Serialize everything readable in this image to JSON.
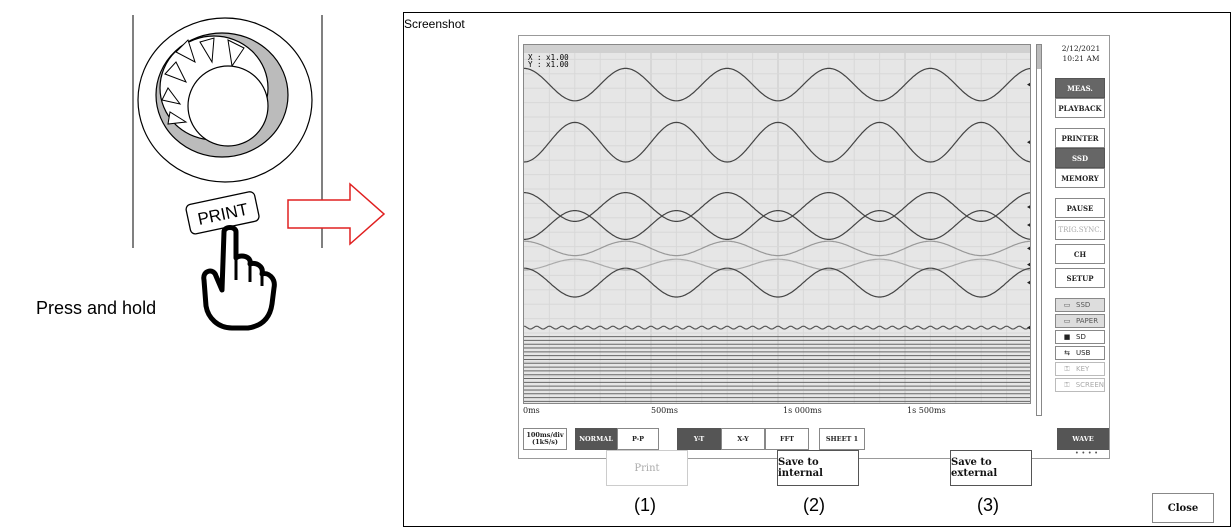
{
  "instruction": {
    "text": "Press and hold"
  },
  "illustration": {
    "print_key_label": "PRINT"
  },
  "dialog": {
    "title": "Screenshot",
    "buttons": {
      "print": "Print",
      "save_internal": "Save to internal",
      "save_external": "Save to external",
      "close": "Close"
    },
    "markers": [
      "(1)",
      "(2)",
      "(3)"
    ]
  },
  "screen": {
    "zoom": {
      "x": "X : x1.00",
      "y": "Y : x1.00"
    },
    "datetime": {
      "date": "2/12/2021",
      "time": "10:21 AM"
    },
    "x_ticks": [
      "0ms",
      "500ms",
      "1s 000ms",
      "1s 500ms"
    ],
    "side_buttons": [
      {
        "label": "MEAS.",
        "state": "active"
      },
      {
        "label": "PLAYBACK",
        "state": "normal"
      },
      {
        "label": "PRINTER",
        "state": "normal"
      },
      {
        "label": "SSD",
        "state": "active"
      },
      {
        "label": "MEMORY",
        "state": "normal"
      },
      {
        "label": "PAUSE",
        "state": "normal"
      },
      {
        "label": "TRIG.SYNC.",
        "state": "disabled"
      },
      {
        "label": "CH",
        "state": "normal"
      },
      {
        "label": "SETUP",
        "state": "normal"
      }
    ],
    "save_targets": [
      {
        "icon": "ssd-icon",
        "label": "SSD",
        "state": "selected"
      },
      {
        "icon": "paper-icon",
        "label": "PAPER",
        "state": "selected"
      },
      {
        "icon": "sd-card-icon",
        "label": "SD",
        "state": "normal"
      },
      {
        "icon": "usb-icon",
        "label": "USB",
        "state": "normal"
      },
      {
        "icon": "key-icon",
        "label": "KEY",
        "state": "disabled"
      },
      {
        "icon": "screen-icon",
        "label": "SCREEN",
        "state": "disabled"
      }
    ],
    "toolbar": {
      "timebase": "100ms/div (1kS/s)",
      "normal": "NORMAL",
      "pp": "P-P",
      "yt": "Y-T",
      "xy": "X-Y",
      "fft": "FFT",
      "sheet": "SHEET 1",
      "wave": "WAVE",
      "wave_dots": "• • • •"
    },
    "waveforms": [
      {
        "baseline": 0.11,
        "amplitude": 0.045,
        "cycles": 5,
        "phase": 0.0,
        "color": "#444444"
      },
      {
        "baseline": 0.27,
        "amplitude": 0.055,
        "cycles": 5,
        "phase": 3.14,
        "color": "#444444"
      },
      {
        "baseline": 0.45,
        "amplitude": 0.04,
        "cycles": 5,
        "phase": 0.0,
        "color": "#444444"
      },
      {
        "baseline": 0.5,
        "amplitude": 0.04,
        "cycles": 5,
        "phase": 3.14,
        "color": "#444444"
      },
      {
        "baseline": 0.565,
        "amplitude": 0.02,
        "cycles": 5,
        "phase": 0.0,
        "color": "#999999"
      },
      {
        "baseline": 0.61,
        "amplitude": 0.015,
        "cycles": 5,
        "phase": 3.14,
        "color": "#aaaaaa"
      },
      {
        "baseline": 0.66,
        "amplitude": 0.04,
        "cycles": 5,
        "phase": 0.0,
        "color": "#444444"
      },
      {
        "baseline": 0.785,
        "amplitude": 0.004,
        "cycles": 40,
        "phase": 0.0,
        "color": "#555555"
      }
    ],
    "flat_lines": {
      "start": 0.81,
      "end": 0.99,
      "count": 18,
      "color": "#666666"
    }
  }
}
